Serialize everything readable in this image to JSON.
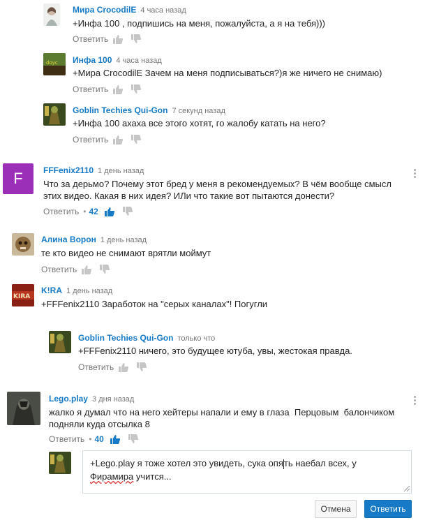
{
  "comments": [
    {
      "author": "Мира CrocodilE",
      "time": "4 часа назад",
      "text": "+Инфа 100 , подпишись на меня, пожалуйста, а я на тебя)))",
      "reply": "Ответить",
      "likes": ""
    },
    {
      "author": "Инфа 100",
      "time": "4 часа назад",
      "text": "+Мира CrocodilE Зачем на меня подписываться?)я же ничего не снимаю)",
      "reply": "Ответить",
      "likes": ""
    },
    {
      "author": "Goblin Techies Qui-Gon",
      "time": "7 секунд назад",
      "text": "+Инфа 100 ахаха все этого хотят, го жалобу катать на него?",
      "reply": "Ответить",
      "likes": ""
    },
    {
      "author": "FFFenix2110",
      "time": "1 день назад",
      "text": "Что за дерьмо? Почему этот бред у меня в рекомендуемых? В чём вообще смысл\nэтих видео. Какая в них идея? ИЛи что такие вот пытаются донести?",
      "reply": "Ответить",
      "likes": "42",
      "avatar_letter": "F"
    },
    {
      "author": "Алина Ворон",
      "time": "1 день назад",
      "text": "те кто видео не снимают врятли моймут",
      "reply": "Ответить",
      "likes": ""
    },
    {
      "author": "K!RA",
      "time": "1 день назад",
      "text": "+FFFenix2110 Заработок на \"серых каналах\"! Погугли",
      "reply": "Ответить",
      "likes": "",
      "avatar_text": "KIRA"
    },
    {
      "author": "Goblin Techies Qui-Gon",
      "time": "только что",
      "text": "+FFFenix2110 ничего, это будущее ютуба, увы, жестокая правда.",
      "reply": "Ответить",
      "likes": ""
    },
    {
      "author": "Lego.play",
      "time": "3 дня назад",
      "text": "жалко я думал что на него хейтеры напали и ему в глаза  Перцовым  балончиком\nподняли куда отсылка 8",
      "reply": "Ответить",
      "likes": "40"
    }
  ],
  "reply_box": {
    "text_before": "+Lego.play я тоже хотел это увидеть, сука опя",
    "text_after": "ть наебал всех, у ",
    "line2_misspelled": "Фирамира",
    "line2_rest": " учится..."
  },
  "buttons": {
    "cancel": "Отмена",
    "submit": "Ответить"
  },
  "colors": {
    "link": "#167ac6",
    "avatar_purple": "#9c2fb8",
    "submit": "#167ac6"
  }
}
